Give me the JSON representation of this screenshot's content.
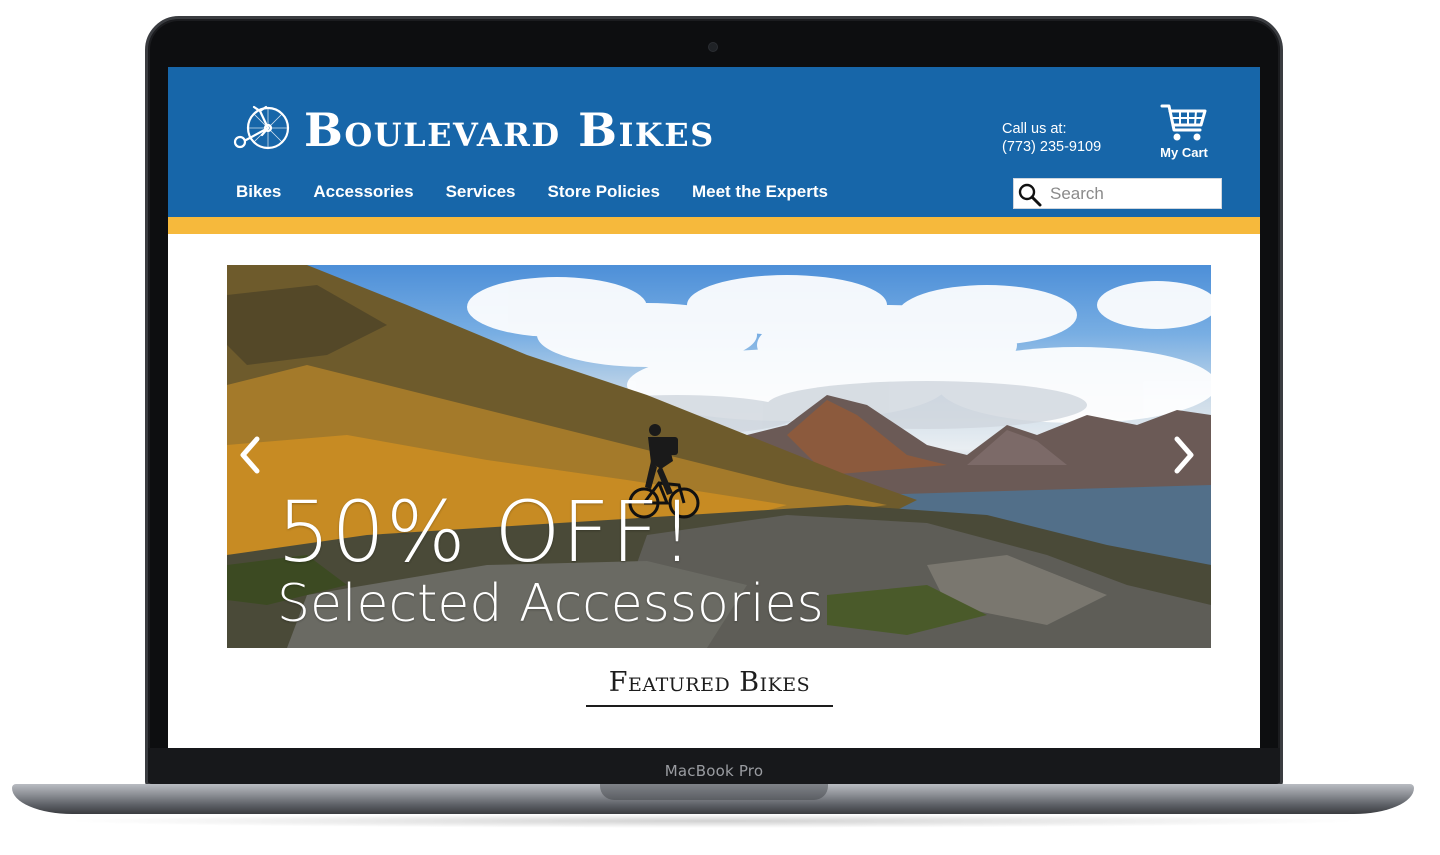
{
  "device": {
    "label": "MacBook Pro"
  },
  "header": {
    "brand": "Boulevard Bikes",
    "call_label": "Call us at:",
    "phone": "(773) 235-9109",
    "cart_label": "My Cart",
    "cart_icon": "shopping-cart-icon",
    "logo_icon": "penny-farthing-icon",
    "colors": {
      "header_bg": "#1766a9",
      "accent_stripe": "#f6b93c"
    }
  },
  "nav": {
    "items": [
      {
        "label": "Bikes"
      },
      {
        "label": "Accessories"
      },
      {
        "label": "Services"
      },
      {
        "label": "Store Policies"
      },
      {
        "label": "Meet the Experts"
      }
    ]
  },
  "search": {
    "placeholder": "Search",
    "value": ""
  },
  "hero": {
    "headline": "50% OFF!",
    "subheadline": "Selected Accessories",
    "prev_icon": "chevron-left-icon",
    "next_icon": "chevron-right-icon"
  },
  "main": {
    "section_title": "Featured Bikes"
  }
}
